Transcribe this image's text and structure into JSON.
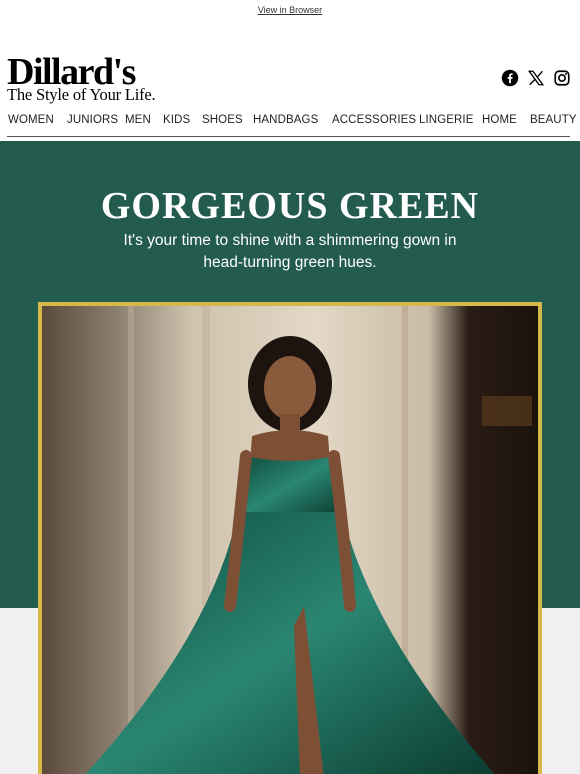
{
  "header": {
    "view_in_browser": "View in Browser",
    "logo_word": "Dillard's",
    "logo_tagline": "The Style of Your Life."
  },
  "social": [
    {
      "icon": "facebook-icon"
    },
    {
      "icon": "x-icon"
    },
    {
      "icon": "instagram-icon"
    }
  ],
  "nav": {
    "items": [
      "WOMEN",
      "JUNIORS",
      "MEN",
      "KIDS",
      "SHOES",
      "HANDBAGS",
      "ACCESSORIES",
      "LINGERIE",
      "HOME",
      "BEAUTY"
    ]
  },
  "hero": {
    "title": "GORGEOUS GREEN",
    "subtitle": "It's your time to shine with a shimmering gown in head-turning green hues.",
    "background_color": "#235b4f",
    "frame_color": "#d4b84a"
  }
}
